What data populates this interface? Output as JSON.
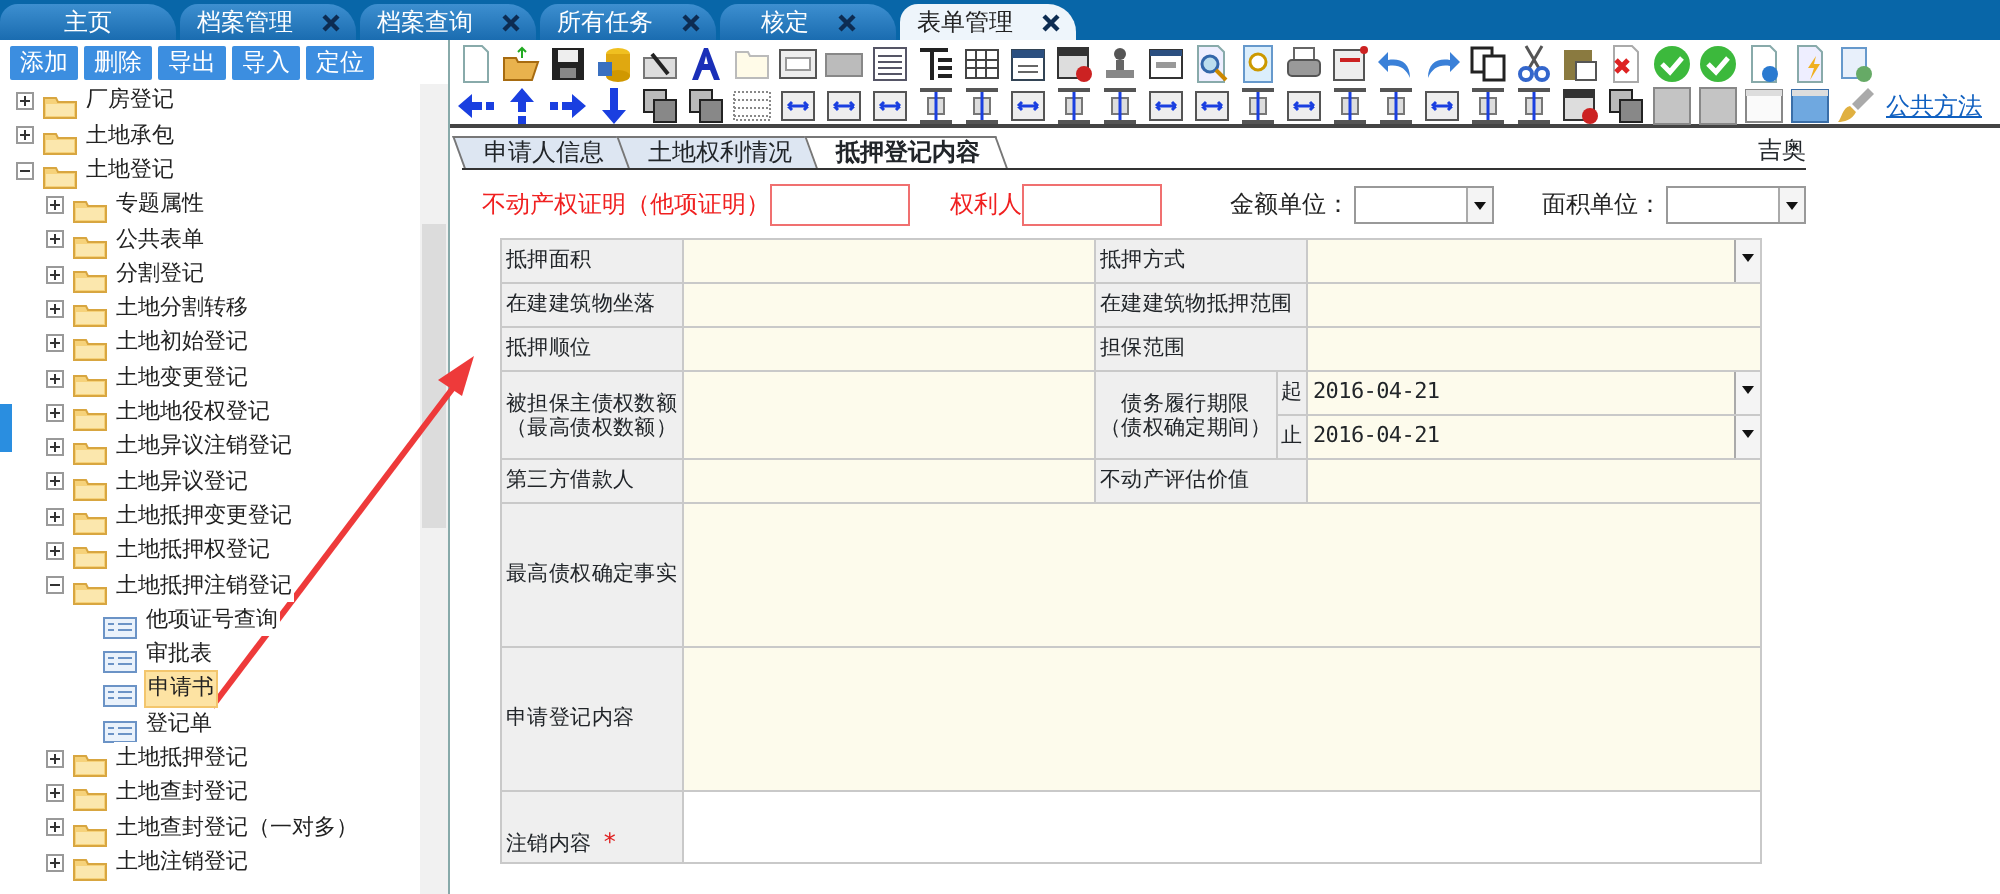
{
  "top_tabs": [
    {
      "label": "主页",
      "closable": false,
      "selected": false
    },
    {
      "label": "档案管理",
      "closable": true,
      "selected": false
    },
    {
      "label": "档案查询",
      "closable": true,
      "selected": false
    },
    {
      "label": "所有任务",
      "closable": true,
      "selected": false
    },
    {
      "label": "核定",
      "closable": true,
      "selected": false
    },
    {
      "label": "表单管理",
      "closable": true,
      "selected": true
    }
  ],
  "left_toolbar": {
    "buttons": [
      "添加",
      "删除",
      "导出",
      "导入",
      "定位"
    ]
  },
  "tree": [
    {
      "label": "厂房登记",
      "kind": "folder",
      "expanded": false,
      "selected": false
    },
    {
      "label": "土地承包",
      "kind": "folder",
      "expanded": false,
      "selected": false
    },
    {
      "label": "土地登记",
      "kind": "folder",
      "expanded": true,
      "selected": false,
      "children": [
        {
          "label": "专题属性",
          "kind": "folder",
          "expanded": false,
          "selected": false
        },
        {
          "label": "公共表单",
          "kind": "folder",
          "expanded": false,
          "selected": false
        },
        {
          "label": "分割登记",
          "kind": "folder",
          "expanded": false,
          "selected": false
        },
        {
          "label": "土地分割转移",
          "kind": "folder",
          "expanded": false,
          "selected": false
        },
        {
          "label": "土地初始登记",
          "kind": "folder",
          "expanded": false,
          "selected": false
        },
        {
          "label": "土地变更登记",
          "kind": "folder",
          "expanded": false,
          "selected": false
        },
        {
          "label": "土地地役权登记",
          "kind": "folder",
          "expanded": false,
          "selected": false
        },
        {
          "label": "土地异议注销登记",
          "kind": "folder",
          "expanded": false,
          "selected": false
        },
        {
          "label": "土地异议登记",
          "kind": "folder",
          "expanded": false,
          "selected": false
        },
        {
          "label": "土地抵押变更登记",
          "kind": "folder",
          "expanded": false,
          "selected": false
        },
        {
          "label": "土地抵押权登记",
          "kind": "folder",
          "expanded": false,
          "selected": false
        },
        {
          "label": "土地抵押注销登记",
          "kind": "folder",
          "expanded": true,
          "selected": false,
          "children": [
            {
              "label": "他项证号查询",
              "kind": "form",
              "selected": false
            },
            {
              "label": "审批表",
              "kind": "form",
              "selected": false
            },
            {
              "label": "申请书",
              "kind": "form",
              "selected": true
            },
            {
              "label": "登记单",
              "kind": "form",
              "selected": false
            }
          ]
        },
        {
          "label": "土地抵押登记",
          "kind": "folder",
          "expanded": false,
          "selected": false
        },
        {
          "label": "土地查封登记",
          "kind": "folder",
          "expanded": false,
          "selected": false
        },
        {
          "label": "土地查封登记（一对多）",
          "kind": "folder",
          "expanded": false,
          "selected": false
        },
        {
          "label": "土地注销登记",
          "kind": "folder",
          "expanded": false,
          "selected": false
        }
      ]
    }
  ],
  "toolbar": {
    "link": "公共方法"
  },
  "form_tabs": [
    {
      "label": "申请人信息",
      "selected": false
    },
    {
      "label": "土地权利情况",
      "selected": false
    },
    {
      "label": "抵押登记内容",
      "selected": true
    }
  ],
  "form_corner": "吉奥",
  "header_fields": [
    {
      "label": "不动产权证明（他项证明）",
      "kind": "input",
      "required": true
    },
    {
      "label": "权利人",
      "kind": "input",
      "required": true
    },
    {
      "label": "金额单位：",
      "kind": "select",
      "required": false
    },
    {
      "label": "面积单位：",
      "kind": "select",
      "required": false
    }
  ],
  "table": {
    "rows": [
      {
        "kind": "pair",
        "cells": [
          {
            "label": "抵押面积",
            "dropdown": false
          },
          {
            "label": "抵押方式",
            "dropdown": true
          }
        ]
      },
      {
        "kind": "pair",
        "cells": [
          {
            "label": "在建建筑物坐落",
            "dropdown": false
          },
          {
            "label": "在建建筑物抵押范围",
            "dropdown": false
          }
        ]
      },
      {
        "kind": "pair",
        "cells": [
          {
            "label": "抵押顺位",
            "dropdown": false
          },
          {
            "label": "担保范围",
            "dropdown": false
          }
        ]
      },
      {
        "kind": "period",
        "left_label": [
          "被担保主债权数额",
          "（最高债权数额）"
        ],
        "right_label": [
          "债务履行期限",
          "（债权确定期间）"
        ],
        "dates": [
          {
            "label": "起",
            "value": "2016-04-21"
          },
          {
            "label": "止",
            "value": "2016-04-21"
          }
        ]
      },
      {
        "kind": "pair",
        "cells": [
          {
            "label": "第三方借款人",
            "dropdown": false
          },
          {
            "label": "不动产评估价值",
            "dropdown": false
          }
        ]
      },
      {
        "kind": "wide",
        "label": "最高债权确定事实",
        "required": false
      },
      {
        "kind": "wide",
        "label": "申请登记内容",
        "required": false
      },
      {
        "kind": "wide",
        "label": "注销内容",
        "required": true,
        "required_mark": "*"
      }
    ]
  }
}
